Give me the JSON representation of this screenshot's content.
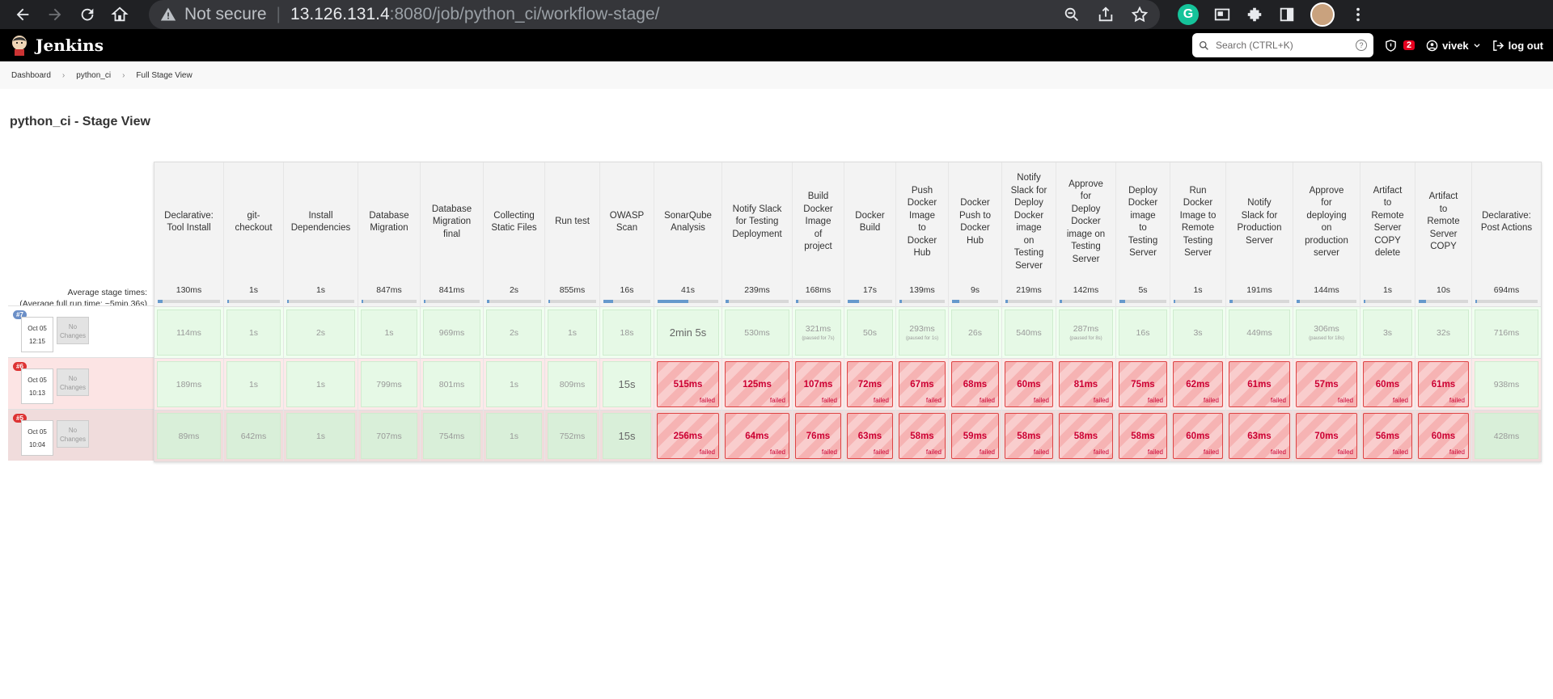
{
  "browser": {
    "not_secure": "Not secure",
    "host": "13.126.131.4",
    "path": ":8080/job/python_ci/workflow-stage/",
    "grammarly": "G"
  },
  "jenkins": {
    "title": "Jenkins",
    "search_placeholder": "Search (CTRL+K)",
    "search_help": "?",
    "security_count": "2",
    "user": "vivek",
    "logout": "log out"
  },
  "breadcrumb": [
    "Dashboard",
    "python_ci",
    "Full Stage View"
  ],
  "page_title": "python_ci - Stage View",
  "avg_label": "Average stage times:",
  "avg_full_prefix": "(Average ",
  "avg_full_word": "full",
  "avg_full_suffix": " run time: ~5min 36s)",
  "stages": [
    {
      "name": "Declarative:\nTool Install",
      "avg": "130ms",
      "bar": 0.08
    },
    {
      "name": "git-\ncheckout",
      "avg": "1s",
      "bar": 0.03
    },
    {
      "name": "Install\nDependencies",
      "avg": "1s",
      "bar": 0.03
    },
    {
      "name": "Database\nMigration",
      "avg": "847ms",
      "bar": 0.03
    },
    {
      "name": "Database\nMigration\nfinal",
      "avg": "841ms",
      "bar": 0.03
    },
    {
      "name": "Collecting\nStatic Files",
      "avg": "2s",
      "bar": 0.05
    },
    {
      "name": "Run test",
      "avg": "855ms",
      "bar": 0.03
    },
    {
      "name": "OWASP\nScan",
      "avg": "16s",
      "bar": 0.2
    },
    {
      "name": "SonarQube\nAnalysis",
      "avg": "41s",
      "bar": 0.5
    },
    {
      "name": "Notify Slack\nfor Testing\nDeployment",
      "avg": "239ms",
      "bar": 0.05
    },
    {
      "name": "Build\nDocker\nImage\nof\nproject",
      "avg": "168ms",
      "bar": 0.05
    },
    {
      "name": "Docker\nBuild",
      "avg": "17s",
      "bar": 0.25
    },
    {
      "name": "Push\nDocker\nImage\nto\nDocker\nHub",
      "avg": "139ms",
      "bar": 0.05
    },
    {
      "name": "Docker\nPush to\nDocker\nHub",
      "avg": "9s",
      "bar": 0.15
    },
    {
      "name": "Notify\nSlack for\nDeploy\nDocker\nimage\non\nTesting\nServer",
      "avg": "219ms",
      "bar": 0.05
    },
    {
      "name": "Approve\nfor\nDeploy\nDocker\nimage on\nTesting\nServer",
      "avg": "142ms",
      "bar": 0.05
    },
    {
      "name": "Deploy\nDocker\nimage\nto\nTesting\nServer",
      "avg": "5s",
      "bar": 0.12
    },
    {
      "name": "Run\nDocker\nImage to\nRemote\nTesting\nServer",
      "avg": "1s",
      "bar": 0.03
    },
    {
      "name": "Notify\nSlack for\nProduction\nServer",
      "avg": "191ms",
      "bar": 0.05
    },
    {
      "name": "Approve\nfor\ndeploying\non\nproduction\nserver",
      "avg": "144ms",
      "bar": 0.05
    },
    {
      "name": "Artifact\nto\nRemote\nServer\nCOPY\ndelete",
      "avg": "1s",
      "bar": 0.03
    },
    {
      "name": "Artifact\nto\nRemote\nServer\nCOPY",
      "avg": "10s",
      "bar": 0.15
    },
    {
      "name": "Declarative:\nPost Actions",
      "avg": "694ms",
      "bar": 0.03
    }
  ],
  "runs": [
    {
      "id": "#7",
      "date": "Oct 05",
      "time": "12:15",
      "nochanges": "No\nChanges",
      "cells": [
        {
          "t": "114ms",
          "s": "ok"
        },
        {
          "t": "1s",
          "s": "ok"
        },
        {
          "t": "2s",
          "s": "ok"
        },
        {
          "t": "1s",
          "s": "ok"
        },
        {
          "t": "969ms",
          "s": "ok"
        },
        {
          "t": "2s",
          "s": "ok"
        },
        {
          "t": "1s",
          "s": "ok"
        },
        {
          "t": "18s",
          "s": "ok"
        },
        {
          "t": "2min 5s",
          "s": "ok",
          "big": true
        },
        {
          "t": "530ms",
          "s": "ok"
        },
        {
          "t": "321ms",
          "s": "ok",
          "p": "(paused for 7s)"
        },
        {
          "t": "50s",
          "s": "ok"
        },
        {
          "t": "293ms",
          "s": "ok",
          "p": "(paused for 1s)"
        },
        {
          "t": "26s",
          "s": "ok"
        },
        {
          "t": "540ms",
          "s": "ok"
        },
        {
          "t": "287ms",
          "s": "ok",
          "p": "(paused for 8s)"
        },
        {
          "t": "16s",
          "s": "ok"
        },
        {
          "t": "3s",
          "s": "ok"
        },
        {
          "t": "449ms",
          "s": "ok"
        },
        {
          "t": "306ms",
          "s": "ok",
          "p": "(paused for 18s)"
        },
        {
          "t": "3s",
          "s": "ok"
        },
        {
          "t": "32s",
          "s": "ok"
        },
        {
          "t": "716ms",
          "s": "ok"
        }
      ]
    },
    {
      "id": "#6",
      "date": "Oct 05",
      "time": "10:13",
      "nochanges": "No\nChanges",
      "cells": [
        {
          "t": "189ms",
          "s": "ok"
        },
        {
          "t": "1s",
          "s": "ok"
        },
        {
          "t": "1s",
          "s": "ok"
        },
        {
          "t": "799ms",
          "s": "ok"
        },
        {
          "t": "801ms",
          "s": "ok"
        },
        {
          "t": "1s",
          "s": "ok"
        },
        {
          "t": "809ms",
          "s": "ok"
        },
        {
          "t": "15s",
          "s": "ok",
          "big": true
        },
        {
          "t": "515ms",
          "s": "fail"
        },
        {
          "t": "125ms",
          "s": "fail"
        },
        {
          "t": "107ms",
          "s": "fail"
        },
        {
          "t": "72ms",
          "s": "fail"
        },
        {
          "t": "67ms",
          "s": "fail"
        },
        {
          "t": "68ms",
          "s": "fail"
        },
        {
          "t": "60ms",
          "s": "fail"
        },
        {
          "t": "81ms",
          "s": "fail"
        },
        {
          "t": "75ms",
          "s": "fail"
        },
        {
          "t": "62ms",
          "s": "fail"
        },
        {
          "t": "61ms",
          "s": "fail"
        },
        {
          "t": "57ms",
          "s": "fail"
        },
        {
          "t": "60ms",
          "s": "fail"
        },
        {
          "t": "61ms",
          "s": "fail"
        },
        {
          "t": "938ms",
          "s": "ok"
        }
      ]
    },
    {
      "id": "#5",
      "date": "Oct 05",
      "time": "10:04",
      "nochanges": "No\nChanges",
      "cells": [
        {
          "t": "89ms",
          "s": "ok"
        },
        {
          "t": "642ms",
          "s": "ok"
        },
        {
          "t": "1s",
          "s": "ok"
        },
        {
          "t": "707ms",
          "s": "ok"
        },
        {
          "t": "754ms",
          "s": "ok"
        },
        {
          "t": "1s",
          "s": "ok"
        },
        {
          "t": "752ms",
          "s": "ok"
        },
        {
          "t": "15s",
          "s": "ok",
          "big": true
        },
        {
          "t": "256ms",
          "s": "fail"
        },
        {
          "t": "64ms",
          "s": "fail"
        },
        {
          "t": "76ms",
          "s": "fail"
        },
        {
          "t": "63ms",
          "s": "fail"
        },
        {
          "t": "58ms",
          "s": "fail"
        },
        {
          "t": "59ms",
          "s": "fail"
        },
        {
          "t": "58ms",
          "s": "fail"
        },
        {
          "t": "58ms",
          "s": "fail"
        },
        {
          "t": "58ms",
          "s": "fail"
        },
        {
          "t": "60ms",
          "s": "fail"
        },
        {
          "t": "63ms",
          "s": "fail"
        },
        {
          "t": "70ms",
          "s": "fail"
        },
        {
          "t": "56ms",
          "s": "fail"
        },
        {
          "t": "60ms",
          "s": "fail"
        },
        {
          "t": "428ms",
          "s": "ok"
        }
      ]
    }
  ],
  "failed_label": "failed",
  "colors": {
    "run7_badge": "#6b8fc7",
    "run6_badge": "#d33",
    "run5_badge": "#d33"
  }
}
